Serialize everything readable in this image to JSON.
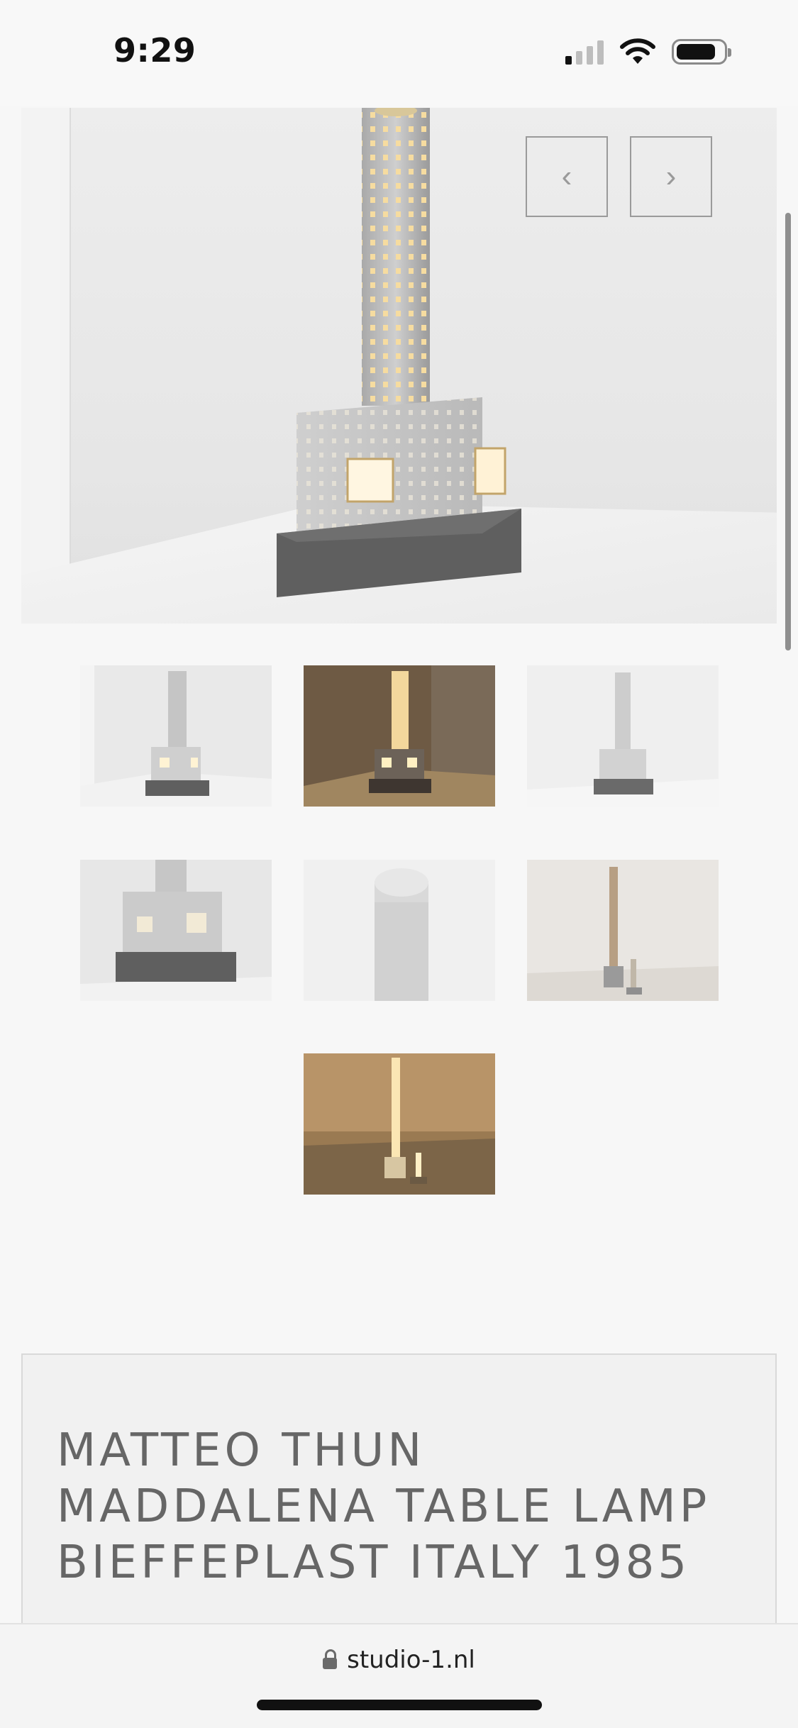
{
  "status_bar": {
    "time": "9:29",
    "signal_bars_on": 1,
    "signal_bars_total": 4,
    "battery_level": 0.85,
    "icons": [
      "cellular-signal-icon",
      "wifi-icon",
      "battery-icon"
    ]
  },
  "gallery": {
    "prev_icon": "‹",
    "next_icon": "›",
    "thumbnails": [
      "thumbnail-1",
      "thumbnail-2",
      "thumbnail-3",
      "thumbnail-4",
      "thumbnail-5",
      "thumbnail-6",
      "thumbnail-7"
    ]
  },
  "product": {
    "title": "MATTEO THUN MADDALENA TABLE LAMP BIEFFEPLAST ITALY 1985"
  },
  "browser": {
    "url": "studio-1.nl",
    "lock_icon": "lock-icon"
  },
  "colors": {
    "background": "#f7f7f7",
    "title_text": "#666666",
    "nav_border": "#9a9a9a",
    "lamp_metal": "#c8c8c8",
    "lamp_base": "#5f5f5f",
    "lamp_glow": "#f5d9a0"
  }
}
